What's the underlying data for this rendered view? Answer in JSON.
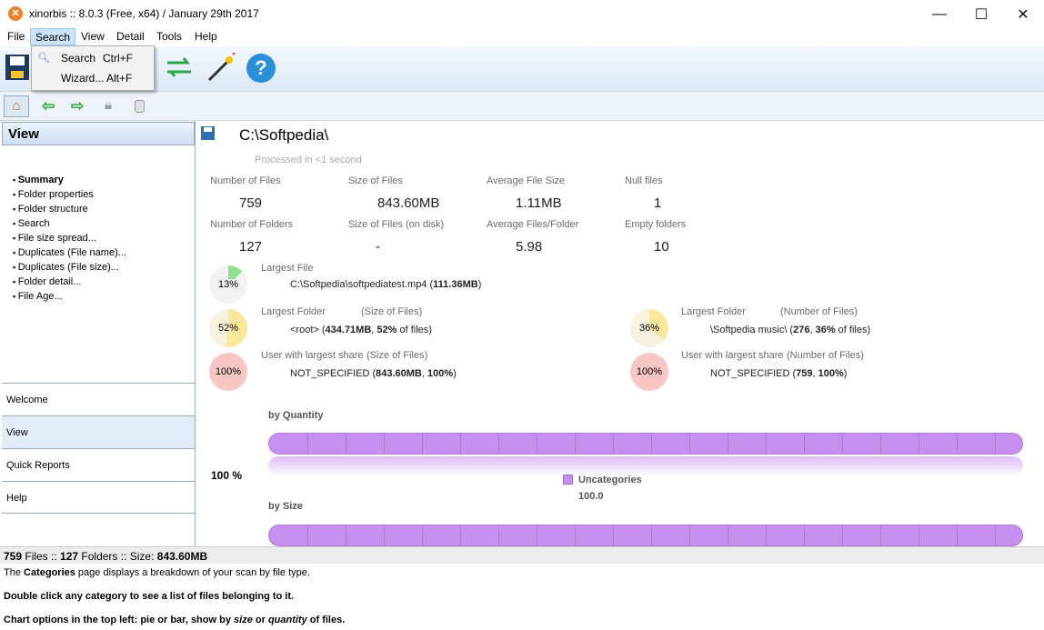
{
  "window": {
    "title": "xinorbis :: 8.0.3 (Free, x64) / January 29th 2017",
    "app_icon": "x-logo-icon"
  },
  "menu": {
    "file": "File",
    "search": "Search",
    "view": "View",
    "detail": "Detail",
    "tools": "Tools",
    "help": "Help"
  },
  "dropdown": {
    "items": [
      {
        "label": "Search",
        "shortcut": "Ctrl+F"
      },
      {
        "label": "Wizard...",
        "shortcut": "Alt+F"
      }
    ]
  },
  "left": {
    "header": "View",
    "links": [
      "Summary",
      "Folder properties",
      "Folder structure",
      "Search",
      "File size spread...",
      "Duplicates (File name)...",
      "Duplicates (File size)...",
      "Folder detail...",
      "File Age..."
    ],
    "tabs": [
      "Welcome",
      "View",
      "Quick Reports",
      "Help"
    ]
  },
  "main": {
    "path": "C:\\Softpedia\\",
    "processed": "Processed in <1 second",
    "stats": [
      {
        "label": "Number of Files",
        "value": "759"
      },
      {
        "label": "Size of Files",
        "value": "843.60MB"
      },
      {
        "label": "Average File Size",
        "value": "1.11MB"
      },
      {
        "label": "Null files",
        "value": "1"
      },
      {
        "label": "Number of Folders",
        "value": "127"
      },
      {
        "label": "Size of Files (on disk)",
        "value": "-"
      },
      {
        "label": "Average Files/Folder",
        "value": "5.98"
      },
      {
        "label": "Empty folders",
        "value": "10"
      }
    ],
    "largest_file": {
      "label": "Largest File",
      "pct": "13%",
      "pre": "C:\\Softpedia\\softpediatest.mp4 (",
      "bold": "111.36MB",
      "post": ")"
    },
    "largest_folder_size": {
      "label": "Largest Folder",
      "sub": "(Size of Files)",
      "pct": "52%",
      "pre": "<root> (",
      "b1": "434.71MB",
      "mid": ", ",
      "b2": "52%",
      "post": " of files)"
    },
    "largest_folder_count": {
      "label": "Largest Folder",
      "sub": "(Number of Files)",
      "pct": "36%",
      "pre": "\\Softpedia music\\ (",
      "b1": "276",
      "mid": ", ",
      "b2": "36%",
      "post": " of files)"
    },
    "user_size": {
      "label": "User with largest share",
      "sub": "(Size of Files)",
      "pct": "100%",
      "pre": "NOT_SPECIFIED (",
      "b1": "843.60MB",
      "mid": ", ",
      "b2": "100%",
      "post": ")"
    },
    "user_count": {
      "label": "User with largest share",
      "sub": "(Number of Files)",
      "pct": "100%",
      "pre": "NOT_SPECIFIED (",
      "b1": "759",
      "mid": ", ",
      "b2": "100%",
      "post": ")"
    },
    "chart": {
      "by_quantity": "by Quantity",
      "by_size": "by Size",
      "pct_label": "100 %",
      "legend_name": "Uncategories",
      "legend_value": "100.0",
      "color": "#c790f0"
    }
  },
  "status": {
    "files_n": "759",
    "files": " Files  ::  ",
    "folders_n": "127",
    "folders": " Folders  ::  Size: ",
    "size": "843.60MB"
  },
  "help": {
    "l1_pre": "The ",
    "l1_bold": "Categories",
    "l1_post": " page displays a breakdown of your scan by file type.",
    "l2": "Double click  any category to see a list of files belonging to it.",
    "l3_pre": "Chart options in the top left: pie or bar, show by ",
    "l3_i1": "size",
    "l3_mid": " or ",
    "l3_i2": "quantity",
    "l3_post": " of files."
  }
}
